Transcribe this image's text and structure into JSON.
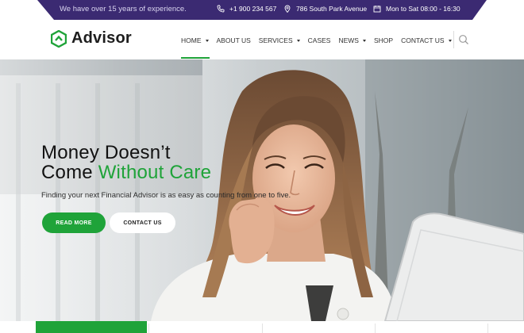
{
  "topbar": {
    "message": "We have over 15 years of experience.",
    "phone": "+1 900 234 567",
    "address": "786 South Park Avenue",
    "hours": "Mon to Sat 08:00 - 16:30",
    "colors": {
      "bar": "#3b2a72",
      "text": "#ffffff"
    }
  },
  "brand": {
    "name": "Advisor",
    "logo_icon": "hexagon-chevron-logo",
    "accent": "#1fa339"
  },
  "nav": {
    "items": [
      {
        "label": "HOME",
        "dropdown": true,
        "active": true
      },
      {
        "label": "ABOUT US",
        "dropdown": false,
        "active": false
      },
      {
        "label": "SERVICES",
        "dropdown": true,
        "active": false
      },
      {
        "label": "CASES",
        "dropdown": false,
        "active": false
      },
      {
        "label": "NEWS",
        "dropdown": true,
        "active": false
      },
      {
        "label": "SHOP",
        "dropdown": false,
        "active": false
      },
      {
        "label": "CONTACT US",
        "dropdown": true,
        "active": false
      }
    ],
    "search_icon": "search-icon"
  },
  "hero": {
    "title_line1": "Money Doesn’t",
    "title_line2_plain": "Come ",
    "title_line2_accent": "Without Care",
    "subtitle": "Finding your next Financial Advisor is as easy as counting from one to five.",
    "primary_button": "READ MORE",
    "secondary_button": "CONTACT US"
  }
}
